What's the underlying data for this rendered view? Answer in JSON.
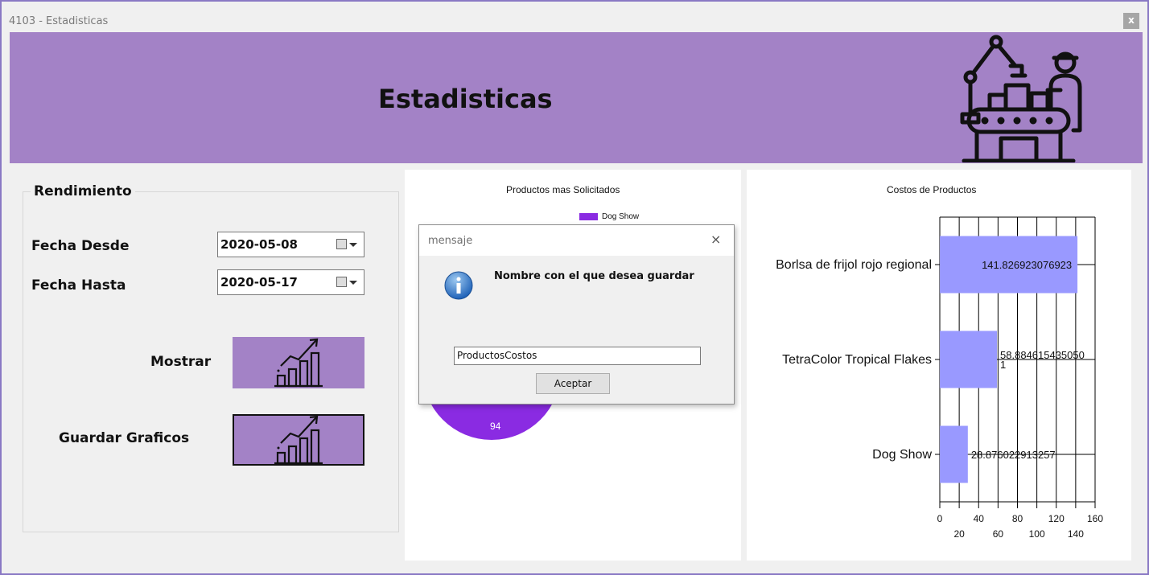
{
  "window": {
    "title": "4103 - Estadisticas",
    "close_glyph": "x"
  },
  "header": {
    "title": "Estadisticas",
    "icon": "factory-icon"
  },
  "rendimiento": {
    "legend": "Rendimiento",
    "fecha_desde_label": "Fecha Desde",
    "fecha_desde_value": "2020-05-08",
    "fecha_hasta_label": "Fecha Hasta",
    "fecha_hasta_value": "2020-05-17",
    "mostrar_label": "Mostrar",
    "guardar_label": "Guardar Graficos",
    "button_icon": "chart-growth-icon"
  },
  "pie_chart": {
    "title": "Productos mas Solicitados",
    "legend_item": "Dog Show",
    "slice_label": "94",
    "color": "#8a2be2"
  },
  "dialog": {
    "title": "mensaje",
    "close_glyph": "×",
    "message": "Nombre con el que desea guardar",
    "input_value": "ProductosCostos",
    "button_label": "Aceptar",
    "icon": "info-icon"
  },
  "chart_data": {
    "type": "bar",
    "orientation": "horizontal",
    "title": "Costos de Productos",
    "categories": [
      "Borlsa de frijol rojo regional",
      "TetraColor Tropical Flakes",
      "Dog Show"
    ],
    "values": [
      141.826923076923,
      58.8846154350501,
      28.876022913257
    ],
    "value_labels": [
      "141.826923076923",
      "58.884615435050 1",
      "28.876022913257"
    ],
    "xlim": [
      0,
      160
    ],
    "ticks_top_row": [
      "0",
      "40",
      "80",
      "120",
      "160"
    ],
    "ticks_bottom_row": [
      "20",
      "60",
      "100",
      "140"
    ],
    "bar_color": "#9999ff",
    "grid": true
  }
}
